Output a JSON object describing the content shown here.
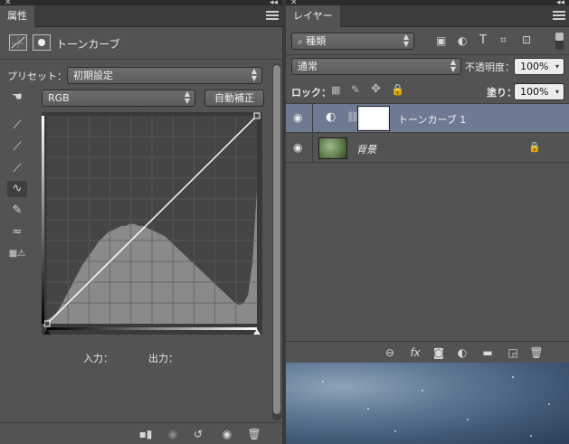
{
  "properties_panel": {
    "tab_label": "属性",
    "header_title": "トーンカーブ",
    "preset_label": "プリセット：",
    "preset_value": "初期設定",
    "channel_value": "RGB",
    "auto_button": "自動補正",
    "input_label": "入力：",
    "output_label": "出力："
  },
  "layers_panel": {
    "tab_label": "レイヤー",
    "filter_value": "種類",
    "blend_mode": "通常",
    "opacity_label": "不透明度：",
    "opacity_value": "100%",
    "lock_label": "ロック：",
    "fill_label": "塗り：",
    "fill_value": "100%",
    "layers": [
      {
        "name": "トーンカーブ 1",
        "selected": true
      },
      {
        "name": "背景",
        "selected": false
      }
    ]
  },
  "icons": [
    "close-icon",
    "collapse-icon",
    "panel-menu-icon",
    "curves-adjust-icon",
    "layer-mask-icon",
    "hand-target-icon",
    "eyedropper-icon",
    "curve-tool-icon",
    "pencil-icon",
    "smooth-icon",
    "clip-warning-icon",
    "visibility-icon",
    "link-icon",
    "fx-icon",
    "mask-icon",
    "adjustment-icon",
    "folder-icon",
    "new-layer-icon",
    "trash-icon",
    "lock-icon"
  ],
  "curve": {
    "histogram": [
      0.02,
      0.03,
      0.05,
      0.08,
      0.12,
      0.16,
      0.2,
      0.24,
      0.28,
      0.31,
      0.34,
      0.37,
      0.4,
      0.42,
      0.44,
      0.45,
      0.46,
      0.47,
      0.47,
      0.48,
      0.48,
      0.47,
      0.47,
      0.46,
      0.45,
      0.44,
      0.43,
      0.42,
      0.4,
      0.38,
      0.36,
      0.34,
      0.32,
      0.3,
      0.28,
      0.26,
      0.24,
      0.22,
      0.2,
      0.18,
      0.16,
      0.14,
      0.12,
      0.1,
      0.09,
      0.1,
      0.14,
      0.3,
      0.65
    ]
  }
}
